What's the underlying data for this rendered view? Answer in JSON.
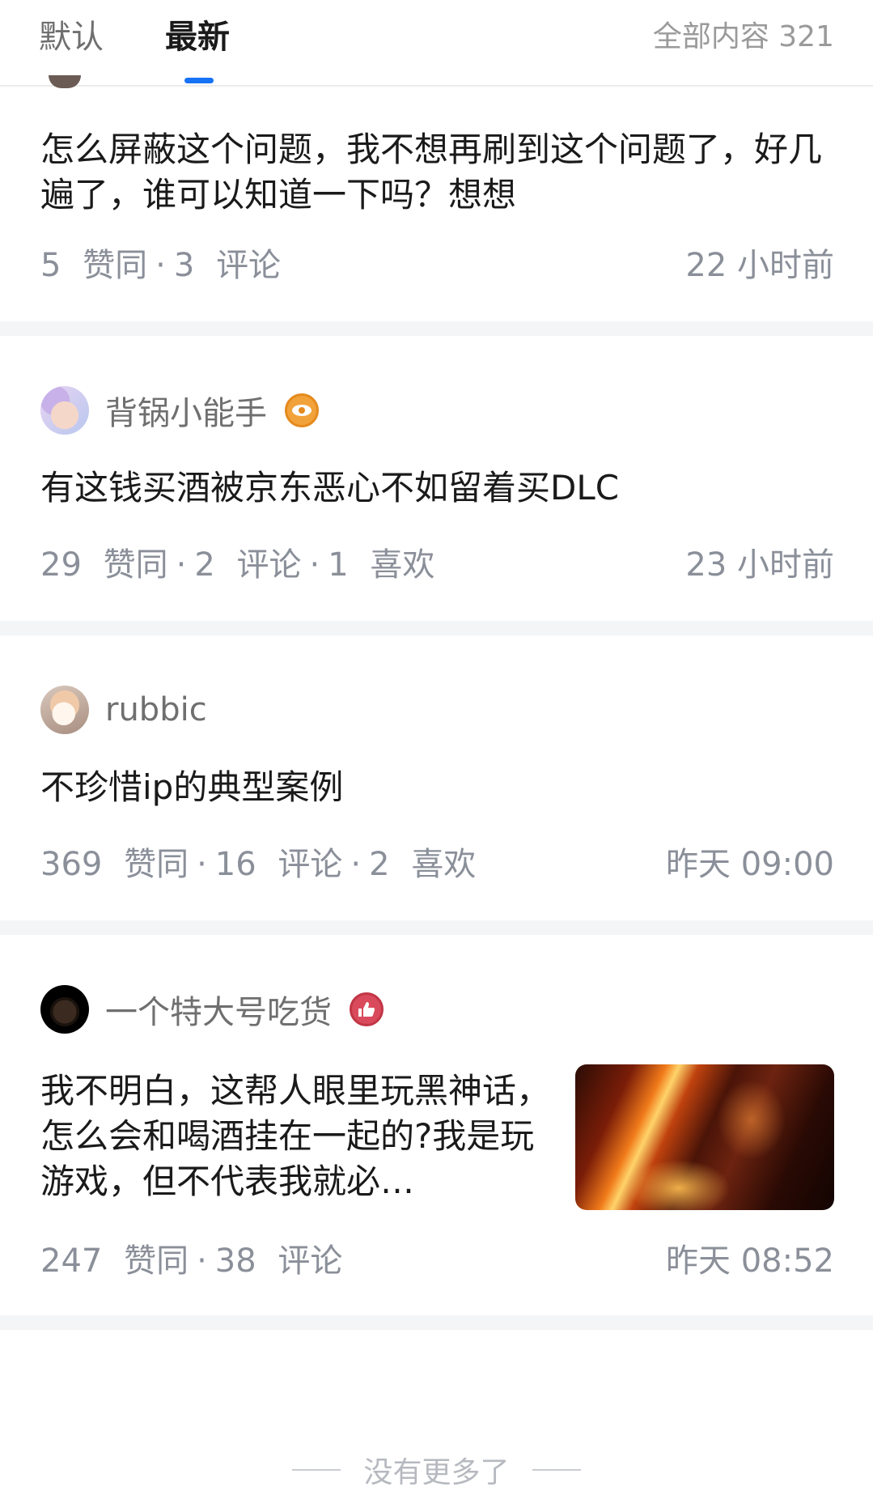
{
  "tabs": {
    "default_label": "默认",
    "latest_label": "最新",
    "total_label": "全部内容 321"
  },
  "posts": [
    {
      "content": "怎么屏蔽这个问题，我不想再刷到这个问题了，好几遍了，谁可以知道一下吗？想想",
      "likes": "5",
      "likes_label": "赞同",
      "comments": "3",
      "comments_label": "评论",
      "time": "22 小时前"
    },
    {
      "author": "背锅小能手",
      "badge_icon": "eye-icon",
      "content": "有这钱买酒被京东恶心不如留着买DLC",
      "likes": "29",
      "likes_label": "赞同",
      "comments": "2",
      "comments_label": "评论",
      "favs": "1",
      "favs_label": "喜欢",
      "time": "23 小时前"
    },
    {
      "author": "rubbic",
      "content": "不珍惜ip的典型案例",
      "likes": "369",
      "likes_label": "赞同",
      "comments": "16",
      "comments_label": "评论",
      "favs": "2",
      "favs_label": "喜欢",
      "time": "昨天 09:00"
    },
    {
      "author": "一个特大号吃货",
      "badge_icon": "thumbs-up-icon",
      "content": "我不明白，这帮人眼里玩黑神话，怎么会和喝酒挂在一起的?我是玩游戏，但不代表我就必…",
      "likes": "247",
      "likes_label": "赞同",
      "comments": "38",
      "comments_label": "评论",
      "time": "昨天 08:52"
    }
  ],
  "footer": {
    "end_text": "没有更多了"
  },
  "colors": {
    "accent": "#1772f6",
    "meta": "#8a8f99",
    "separator": "#f4f5f7"
  }
}
